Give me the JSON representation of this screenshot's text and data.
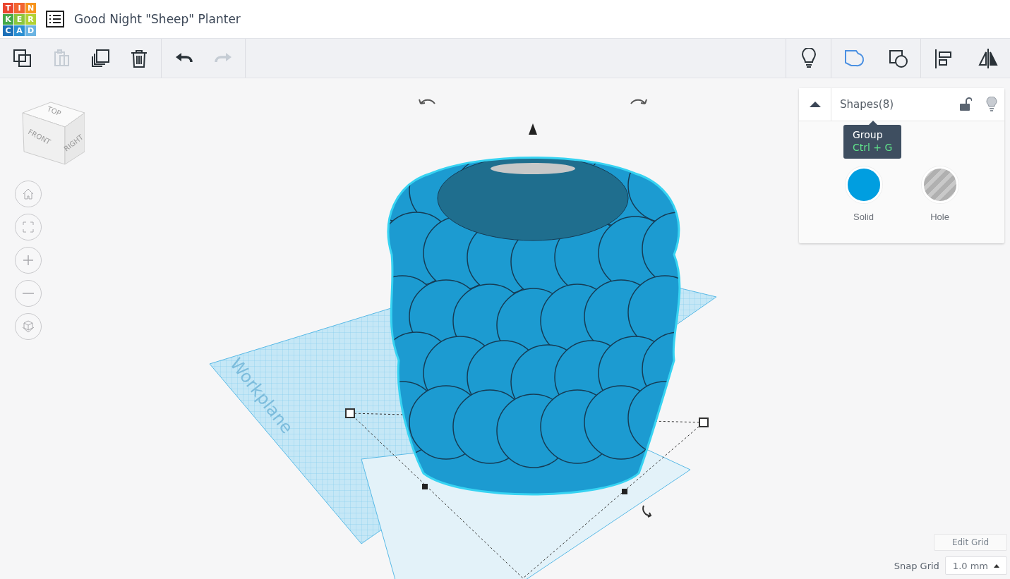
{
  "app": {
    "logo_letters": [
      "T",
      "I",
      "N",
      "K",
      "E",
      "R",
      "C",
      "A",
      "D"
    ],
    "title": "Good Night \"Sheep\" Planter"
  },
  "toolbar": {
    "left": [
      {
        "kind": "copy",
        "disabled": false
      },
      {
        "kind": "paste",
        "disabled": true
      },
      {
        "kind": "duplicate",
        "disabled": false
      },
      {
        "kind": "delete",
        "disabled": false
      },
      {
        "kind": "undo",
        "disabled": false
      },
      {
        "kind": "redo",
        "disabled": true
      }
    ],
    "right": [
      {
        "kind": "bulb",
        "selected": false
      },
      {
        "kind": "group",
        "selected": true
      },
      {
        "kind": "ungroup",
        "selected": false
      },
      {
        "kind": "align",
        "selected": false
      },
      {
        "kind": "mirror",
        "selected": false
      }
    ]
  },
  "tooltip": {
    "title": "Group",
    "shortcut": "Ctrl + G"
  },
  "view_cube": {
    "top": "TOP",
    "front": "FRONT",
    "right": "RIGHT"
  },
  "nav_buttons": [
    {
      "kind": "home"
    },
    {
      "kind": "fit"
    },
    {
      "kind": "zoom_in"
    },
    {
      "kind": "zoom_out"
    },
    {
      "kind": "perspective"
    }
  ],
  "inspector": {
    "title": "Shapes(8)",
    "expanded": true,
    "locked": false,
    "options": [
      {
        "kind": "solid",
        "label": "Solid"
      },
      {
        "kind": "hole",
        "label": "Hole"
      }
    ]
  },
  "workplane": {
    "label": "Workplane"
  },
  "grid": {
    "edit_label": "Edit Grid",
    "snap_label": "Snap Grid",
    "snap_value": "1.0 mm"
  }
}
